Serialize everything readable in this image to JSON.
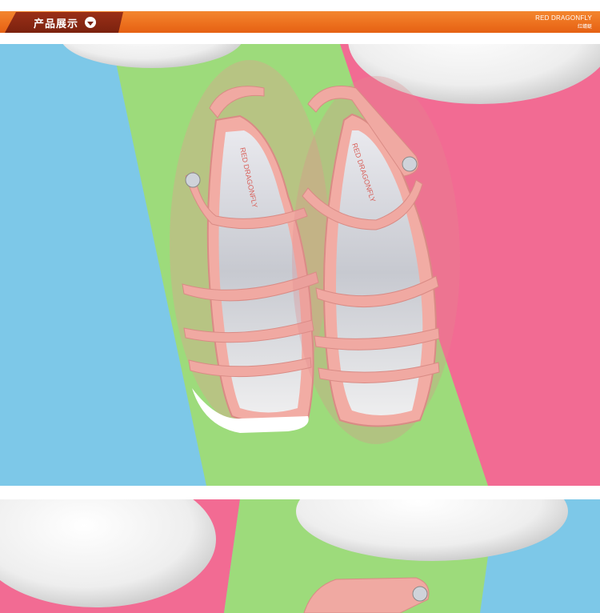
{
  "header": {
    "section_title": "产品展示",
    "brand_en": "RED DRAGONFLY",
    "brand_cn": "红蜻蜓"
  },
  "product": {
    "insole_brand": "RED DRAGONFLY"
  },
  "colors": {
    "header_orange": "#ec6f1d",
    "tab_dark": "#7b220f",
    "bg_blue": "#7dc8e8",
    "bg_green": "#9ddb7b",
    "bg_pink": "#f26b93",
    "sandal_pink": "#f0a9a2"
  }
}
